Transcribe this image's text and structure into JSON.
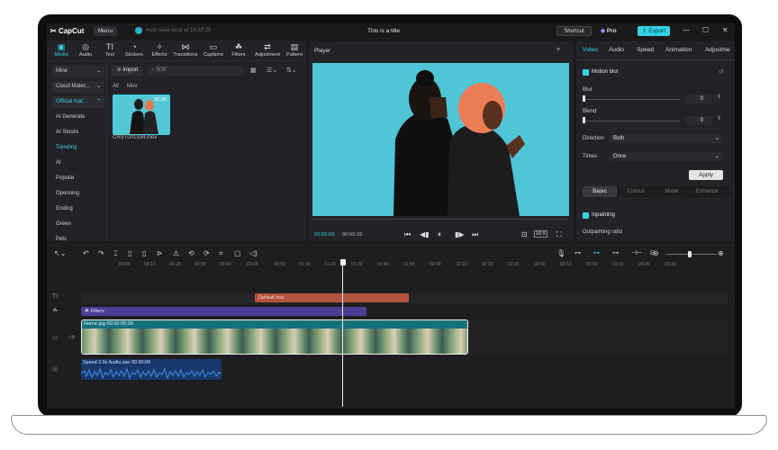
{
  "app": {
    "logo": "CapCut",
    "menu": "Menu",
    "autosave": "Auto save local at 16:30:25",
    "title": "This is a title",
    "shortcut": "Shortcut",
    "pro": "Pro",
    "export": "Export"
  },
  "toolbar": [
    {
      "label": "Media",
      "icon": "▣"
    },
    {
      "label": "Audio",
      "icon": "◎"
    },
    {
      "label": "Text",
      "icon": "TI"
    },
    {
      "label": "Stickers",
      "icon": "◔"
    },
    {
      "label": "Effects",
      "icon": "✧"
    },
    {
      "label": "Transitions",
      "icon": "⋈"
    },
    {
      "label": "Captions",
      "icon": "▭"
    },
    {
      "label": "Filters",
      "icon": "☘"
    },
    {
      "label": "Adjustment",
      "icon": "⇄"
    },
    {
      "label": "Pattern",
      "icon": "▤"
    }
  ],
  "sidebar": {
    "dropdowns": [
      "Mine",
      "Cloud Mater...",
      "Official mat..."
    ],
    "items": [
      "AI Generate",
      "AI Stocks",
      "Trending",
      "AI",
      "Popular",
      "Openning",
      "Ending",
      "Green",
      "Pets"
    ]
  },
  "media": {
    "import": "Import",
    "search_placeholder": "搜索",
    "tabs": [
      "All",
      "Mov"
    ],
    "thumb_duration": "00:05",
    "filename": "CRST001334.mov"
  },
  "player": {
    "title": "Player",
    "current_time": "00:00:00",
    "total_time": "00:00:32",
    "ratio": "16:9"
  },
  "properties": {
    "tabs": [
      "Video",
      "Audio",
      "Speed",
      "Animation",
      "Adjustme"
    ],
    "motion_blur": "Motion blur",
    "blur_label": "Blur",
    "blur_value": "0",
    "blend_label": "Blend",
    "blend_value": "0",
    "direction_label": "Direction",
    "direction_value": "Both",
    "times_label": "Times",
    "times_value": "Once",
    "apply": "Apply",
    "segments": [
      "Basic",
      "Cutout",
      "Mask",
      "Enhance"
    ],
    "inpainting": "Inpainting",
    "outpainting": "Outpainting ratio"
  },
  "timeline": {
    "ruler": [
      "00:00",
      "00:10",
      "00:20",
      "00:30",
      "00:40",
      "01:00",
      "00:50",
      "01:10",
      "01:20",
      "01:30",
      "01:40",
      "01:50",
      "02:00",
      "02:10",
      "02:20",
      "02:30",
      "02:40",
      "02:50",
      "03:00",
      "03:10",
      "03:20",
      "03:30"
    ],
    "text_clip": "Default text",
    "filter_clip": "Filters",
    "video_clip_name": "Name.jpg",
    "video_clip_time": "00:00:05:00",
    "audio_speed": "Speed 2.0x",
    "audio_name": "Audio.aac",
    "audio_time": "00:00:00"
  },
  "colors": {
    "accent": "#34d2e6",
    "text_clip": "#b5533f",
    "filter_clip": "#4a3f95",
    "video_clip": "#16707a",
    "audio_clip": "#17386b"
  }
}
